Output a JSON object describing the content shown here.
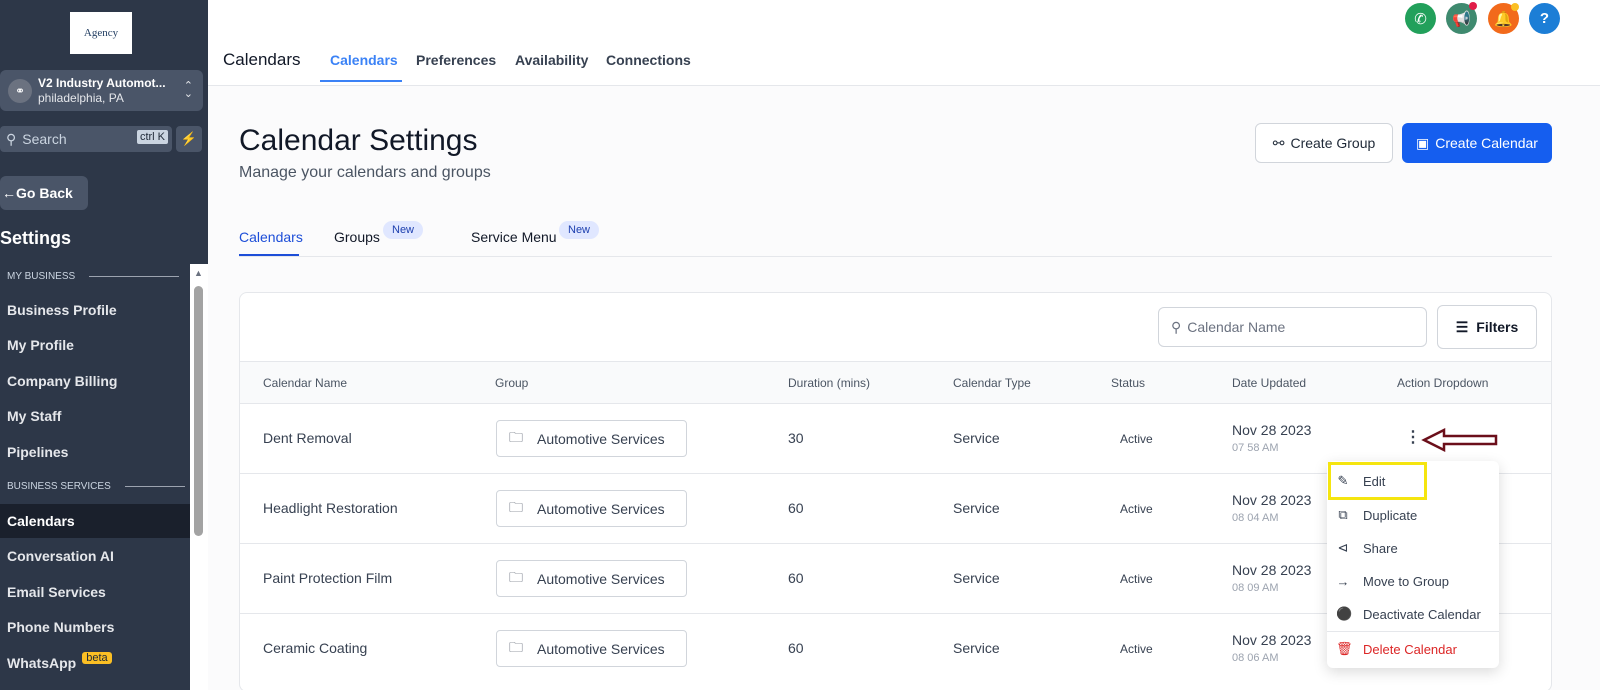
{
  "sidebar": {
    "logo_text": "Agency",
    "account": {
      "name": "V2 Industry Automot...",
      "location": "philadelphia, PA"
    },
    "search": {
      "placeholder": "Search",
      "shortcut": "ctrl K"
    },
    "go_back": "Go Back",
    "heading": "Settings",
    "sections": [
      {
        "label": "MY BUSINESS"
      },
      {
        "label": "BUSINESS SERVICES"
      }
    ],
    "items": [
      {
        "label": "Business Profile"
      },
      {
        "label": "My Profile"
      },
      {
        "label": "Company Billing"
      },
      {
        "label": "My Staff"
      },
      {
        "label": "Pipelines"
      },
      {
        "label": "Calendars",
        "active": true
      },
      {
        "label": "Conversation AI"
      },
      {
        "label": "Email Services"
      },
      {
        "label": "Phone Numbers"
      },
      {
        "label": "WhatsApp",
        "badge": "beta"
      }
    ]
  },
  "header": {
    "title": "Calendars",
    "tabs": [
      {
        "label": "Calendars",
        "active": true
      },
      {
        "label": "Preferences"
      },
      {
        "label": "Availability"
      },
      {
        "label": "Connections"
      }
    ],
    "icons": [
      {
        "name": "phone-icon",
        "color": "#22a05b"
      },
      {
        "name": "megaphone-icon",
        "color": "#3f8a6f"
      },
      {
        "name": "bell-icon",
        "color": "#f26a1b"
      },
      {
        "name": "help-icon",
        "color": "#1c7ed6"
      }
    ]
  },
  "page": {
    "title": "Calendar Settings",
    "subtitle": "Manage your calendars and groups",
    "create_group": "Create Group",
    "create_calendar": "Create Calendar",
    "subtabs": [
      {
        "label": "Calendars",
        "active": true
      },
      {
        "label": "Groups",
        "badge": "New"
      },
      {
        "label": "Service Menu",
        "badge": "New"
      }
    ]
  },
  "table": {
    "search_placeholder": "Calendar Name",
    "filters_label": "Filters",
    "columns": [
      "Calendar Name",
      "Group",
      "Duration (mins)",
      "Calendar Type",
      "Status",
      "Date Updated",
      "Action Dropdown"
    ],
    "rows": [
      {
        "name": "Dent Removal",
        "group": "Automotive Services",
        "duration": "30",
        "type": "Service",
        "status": "Active",
        "date": "Nov 28 2023",
        "time": "07 58 AM"
      },
      {
        "name": "Headlight Restoration",
        "group": "Automotive Services",
        "duration": "60",
        "type": "Service",
        "status": "Active",
        "date": "Nov 28 2023",
        "time": "08 04 AM"
      },
      {
        "name": "Paint Protection Film",
        "group": "Automotive Services",
        "duration": "60",
        "type": "Service",
        "status": "Active",
        "date": "Nov 28 2023",
        "time": "08 09 AM"
      },
      {
        "name": "Ceramic Coating",
        "group": "Automotive Services",
        "duration": "60",
        "type": "Service",
        "status": "Active",
        "date": "Nov 28 2023",
        "time": "08 06 AM"
      }
    ]
  },
  "action_menu": {
    "items": [
      {
        "label": "Edit",
        "icon": "pencil-icon"
      },
      {
        "label": "Duplicate",
        "icon": "duplicate-icon"
      },
      {
        "label": "Share",
        "icon": "share-icon"
      },
      {
        "label": "Move to Group",
        "icon": "arrow-right-icon"
      },
      {
        "label": "Deactivate Calendar",
        "icon": "toggle-icon"
      },
      {
        "label": "Delete Calendar",
        "icon": "trash-icon",
        "color": "#dc2626"
      }
    ]
  }
}
